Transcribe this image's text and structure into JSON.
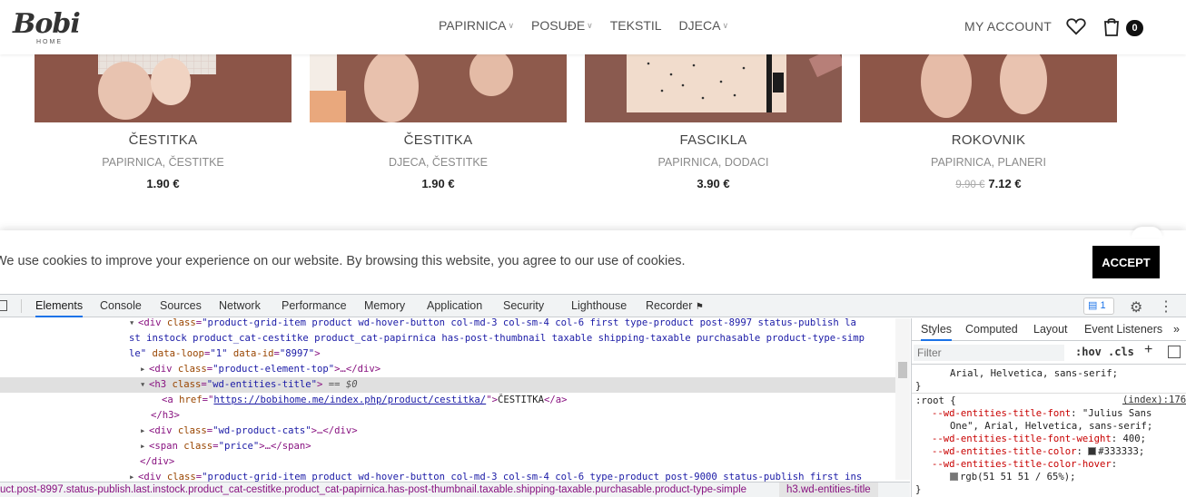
{
  "header": {
    "logo_text": "Bobi",
    "logo_sub": "HOME",
    "nav": [
      {
        "label": "PAPIRNICA",
        "has_dropdown": true
      },
      {
        "label": "POSUĐE",
        "has_dropdown": true
      },
      {
        "label": "TEKSTIL",
        "has_dropdown": false
      },
      {
        "label": "DJECA",
        "has_dropdown": true
      }
    ],
    "account": "MY ACCOUNT",
    "cart_count": "0"
  },
  "products": [
    {
      "title": "ČESTITKA",
      "cats": "PAPIRNICA, ČESTITKE",
      "price": "1.90 €",
      "old_price": ""
    },
    {
      "title": "ČESTITKA",
      "cats": "DJECA, ČESTITKE",
      "price": "1.90 €",
      "old_price": ""
    },
    {
      "title": "FASCIKLA",
      "cats": "PAPIRNICA, DODACI",
      "price": "3.90 €",
      "old_price": ""
    },
    {
      "title": "ROKOVNIK",
      "cats": "PAPIRNICA, PLANERI",
      "price": "7.12 €",
      "old_price": "9.90 €"
    }
  ],
  "cookie": {
    "text": "We use cookies to improve your experience on our website. By browsing this website, you agree to our use of cookies.",
    "accept": "ACCEPT"
  },
  "devtools": {
    "tabs": [
      "Elements",
      "Console",
      "Sources",
      "Network",
      "Performance",
      "Memory",
      "Application",
      "Security",
      "Lighthouse",
      "Recorder"
    ],
    "active_tab": "Elements",
    "issues_count": "1",
    "dom": {
      "l1a": "<div ",
      "l1_attr1": "class",
      "l1_val1": "\"product-grid-item product wd-hover-button  col-md-3 col-sm-4 col-6 first  type-product post-8997 status-publish la",
      "l2": "st instock product_cat-cestitke product_cat-papirnica has-post-thumbnail taxable shipping-taxable purchasable product-type-simp",
      "l3_val": "le\"",
      "l3_attr2": "data-loop",
      "l3_val2": "\"1\"",
      "l3_attr3": "data-id",
      "l3_val3": "\"8997\"",
      "l4_val": "\"product-element-top\"",
      "l5_val": "\"wd-entities-title\"",
      "l5_eq": "== $0",
      "l6_href": "https://bobihome.me/index.php/product/cestitka/",
      "l6_text": "ČESTITKA",
      "l8_val": "\"wd-product-cats\"",
      "l9_val": "\"price\"",
      "l11_val": "\"product-grid-item product wd-hover-button  col-md-3 col-sm-4 col-6 type-product post-9000 status-publish first ins"
    },
    "breadcrumb": {
      "path": "uct.post-8997.status-publish.last.instock.product_cat-cestitke.product_cat-papirnica.has-post-thumbnail.taxable.shipping-taxable.purchasable.product-type-simple",
      "selected": "h3.wd-entities-title"
    },
    "styles": {
      "tabs": [
        "Styles",
        "Computed",
        "Layout",
        "Event Listeners"
      ],
      "filter_placeholder": "Filter",
      "hov": ":hov",
      "cls": ".cls",
      "prev_rule_tail": "Arial, Helvetica, sans-serif;",
      "root_selector": ":root {",
      "root_source": "(index):176",
      "decls": [
        {
          "prop": "--wd-entities-title-font",
          "value": "\"Julius Sans"
        },
        {
          "prop": "",
          "value": "One\", Arial, Helvetica, sans-serif;"
        },
        {
          "prop": "--wd-entities-title-font-weight",
          "value": "400;"
        },
        {
          "prop": "--wd-entities-title-color",
          "value": "#333333;"
        },
        {
          "prop": "--wd-entities-title-color-hover",
          "value": ""
        },
        {
          "prop": "",
          "value": "rgb(51 51 51 / 65%);"
        }
      ]
    }
  },
  "colors": {
    "accent": "#1a73e8",
    "title_color": "#333333",
    "hover_color": "#333333a6"
  }
}
